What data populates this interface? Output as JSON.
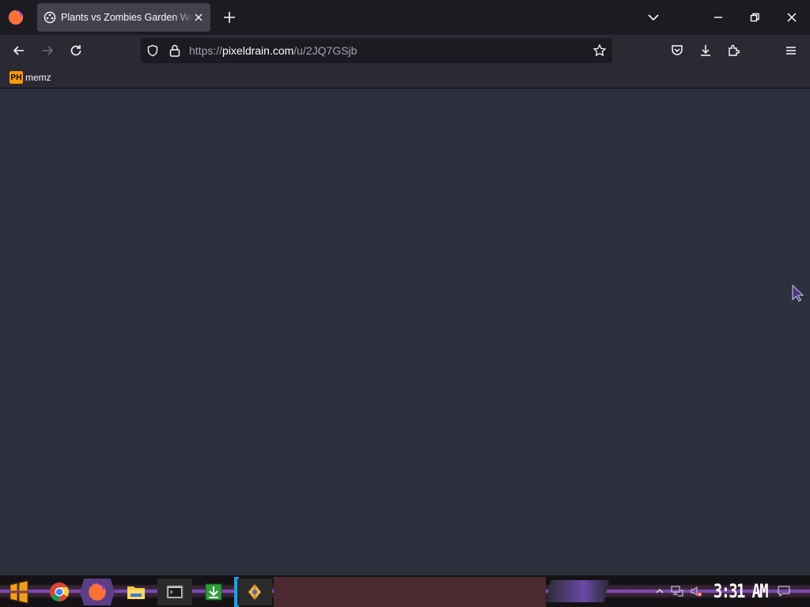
{
  "browser": {
    "tab": {
      "title": "Plants vs Zombies Garden Warfare"
    },
    "url": {
      "protocol": "https://",
      "domain": "pixeldrain.com",
      "path": "/u/2JQ7GSjb"
    },
    "bookmarks": [
      {
        "icon_text": "PH",
        "label": "memz"
      }
    ]
  },
  "taskbar": {
    "clock": "3:31 AM",
    "apps": [
      "start-icon",
      "chrome-icon",
      "firefox-icon",
      "file-explorer-icon",
      "terminal-icon",
      "download-app-icon",
      "paint-icon"
    ]
  },
  "colors": {
    "content_bg": "#2c313d",
    "accent": "#1aa3e8",
    "taskbar_purple": "#7a4ab0"
  }
}
